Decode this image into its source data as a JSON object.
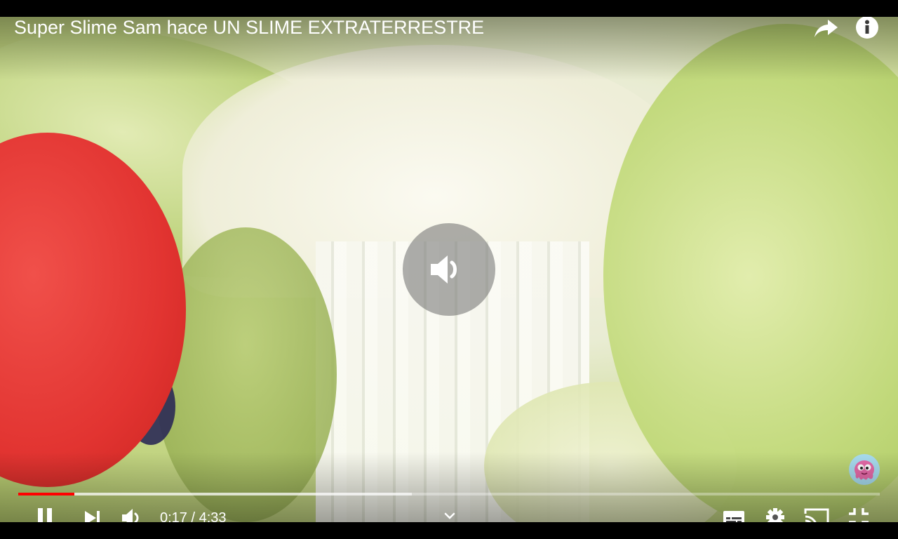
{
  "player": {
    "title": "Super Slime Sam hace UN SLIME EXTRATERRESTRE",
    "current_time": "0:17",
    "duration": "4:33",
    "time_display": "0:17 / 4:33",
    "played_fraction": 0.065,
    "buffered_fraction": 0.457,
    "state": "playing",
    "center_icon": "volume-icon"
  },
  "icons": {
    "top_right": [
      "share-icon",
      "info-icon"
    ],
    "controls_left": [
      "pause-icon",
      "next-icon",
      "volume-icon"
    ],
    "controls_right": [
      "subtitles-icon",
      "settings-icon",
      "cast-icon",
      "exit-fullscreen-icon"
    ],
    "center": "chevron-down-icon",
    "channel_watermark": "channel-logo"
  },
  "colors": {
    "progress_played": "#ff0000",
    "progress_track": "rgba(255,255,255,0.35)",
    "text": "#ffffff"
  }
}
